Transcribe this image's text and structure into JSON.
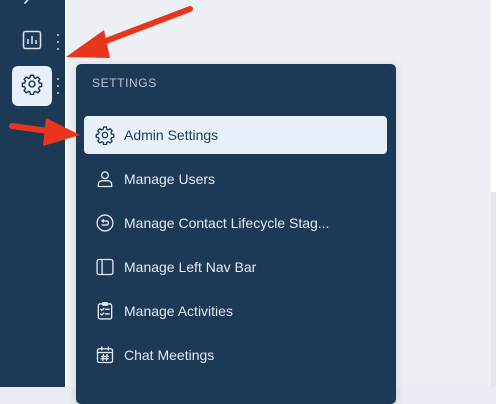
{
  "settings_menu": {
    "header": "SETTINGS",
    "items": [
      {
        "label": "Admin Settings",
        "icon": "gear-icon",
        "active": true
      },
      {
        "label": "Manage Users",
        "icon": "user-icon"
      },
      {
        "label": "Manage Contact Lifecycle Stag...",
        "icon": "lifecycle-icon"
      },
      {
        "label": "Manage Left Nav Bar",
        "icon": "sidebar-layout-icon"
      },
      {
        "label": "Manage Activities",
        "icon": "checklist-icon"
      },
      {
        "label": "Chat Meetings",
        "icon": "calendar-icon"
      }
    ]
  },
  "left_nav": {
    "items": [
      {
        "icon": "partial-icon"
      },
      {
        "icon": "bar-chart-icon"
      },
      {
        "icon": "gear-icon",
        "active": true
      }
    ]
  },
  "colors": {
    "nav_bg": "#1c3a55",
    "active_bg": "#e8f1fb",
    "annotation_arrow": "#e8361e",
    "page_bg": "#eceff4"
  }
}
